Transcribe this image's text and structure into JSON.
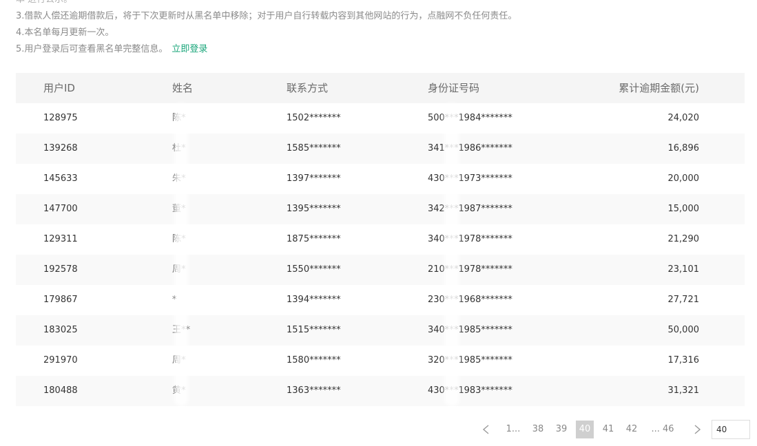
{
  "notes": {
    "line2": "本 进行公示。",
    "line3": "3.借款人偿还逾期借款后，将于下次更新时从黑名单中移除；对于用户自行转载内容到其他网站的行为，点融网不负任何责任。",
    "line4": "4.本名单每月更新一次。",
    "line5": "5.用户登录后可查看黑名单完整信息。",
    "login_link": "立即登录"
  },
  "table": {
    "headers": {
      "id": "用户ID",
      "name": "姓名",
      "phone": "联系方式",
      "idcard": "身份证号码",
      "amount": "累计逾期金额(元)"
    },
    "rows": [
      {
        "id": "128975",
        "name": "陈*",
        "phone": "1502*******",
        "idcard": "500***1984*******",
        "amount": "24,020"
      },
      {
        "id": "139268",
        "name": "杜*",
        "phone": "1585*******",
        "idcard": "341***1986*******",
        "amount": "16,896"
      },
      {
        "id": "145633",
        "name": "朱*",
        "phone": "1397*******",
        "idcard": "430***1973*******",
        "amount": "20,000"
      },
      {
        "id": "147700",
        "name": "董*",
        "phone": "1395*******",
        "idcard": "342***1987*******",
        "amount": "15,000"
      },
      {
        "id": "129311",
        "name": "陈*",
        "phone": "1875*******",
        "idcard": "340***1978*******",
        "amount": "21,290"
      },
      {
        "id": "192578",
        "name": "周*",
        "phone": "1550*******",
        "idcard": "210***1978*******",
        "amount": "23,101"
      },
      {
        "id": "179867",
        "name": "*",
        "phone": "1394*******",
        "idcard": "230***1968*******",
        "amount": "27,721"
      },
      {
        "id": "183025",
        "name": "王**",
        "phone": "1515*******",
        "idcard": "340***1985*******",
        "amount": "50,000"
      },
      {
        "id": "291970",
        "name": "周*",
        "phone": "1580*******",
        "idcard": "320***1985*******",
        "amount": "17,316"
      },
      {
        "id": "180488",
        "name": "黄*",
        "phone": "1363*******",
        "idcard": "430***1983*******",
        "amount": "31,321"
      }
    ]
  },
  "pagination": {
    "first": "1...",
    "pages": [
      "38",
      "39",
      "40",
      "41",
      "42"
    ],
    "last": "... 46",
    "current": "40",
    "jump_value": "40"
  },
  "icons": {
    "prev": "chevron-left-icon",
    "next": "chevron-right-icon"
  },
  "colors": {
    "link": "#1aa67a",
    "header_bg": "#f5f5f5",
    "active_page_bg": "#cfcfcf"
  }
}
